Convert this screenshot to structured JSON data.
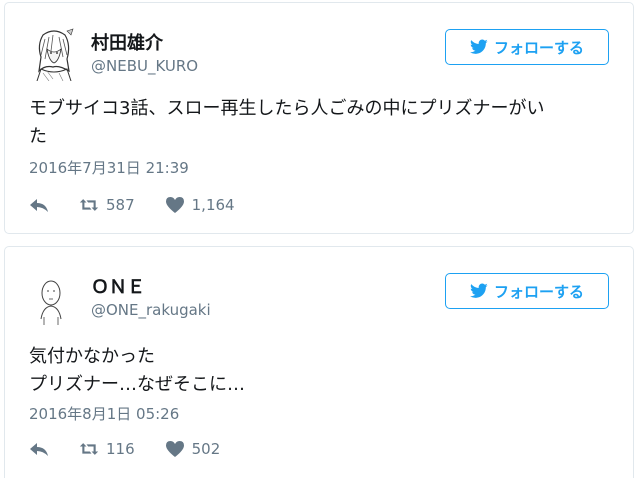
{
  "colors": {
    "accent": "#1da1f2",
    "text": "#14171a",
    "muted": "#657786",
    "border": "#e1e8ed"
  },
  "tweets": [
    {
      "name": "村田雄介",
      "handle": "@NEBU_KURO",
      "follow_label": "フォローする",
      "text": "モブサイコ3話、スロー再生したら人ごみの中にプリズナーがい\nた",
      "timestamp": "2016年7月31日 21:39",
      "retweets": "587",
      "likes": "1,164",
      "avatar_icon": "manga-avatar-icon"
    },
    {
      "name": "ＯＮＥ",
      "handle": "@ONE_rakugaki",
      "follow_label": "フォローする",
      "text": "気付かなかった\nプリズナー…なぜそこに…",
      "timestamp": "2016年8月1日 05:26",
      "retweets": "116",
      "likes": "502",
      "avatar_icon": "doodle-avatar-icon"
    }
  ]
}
